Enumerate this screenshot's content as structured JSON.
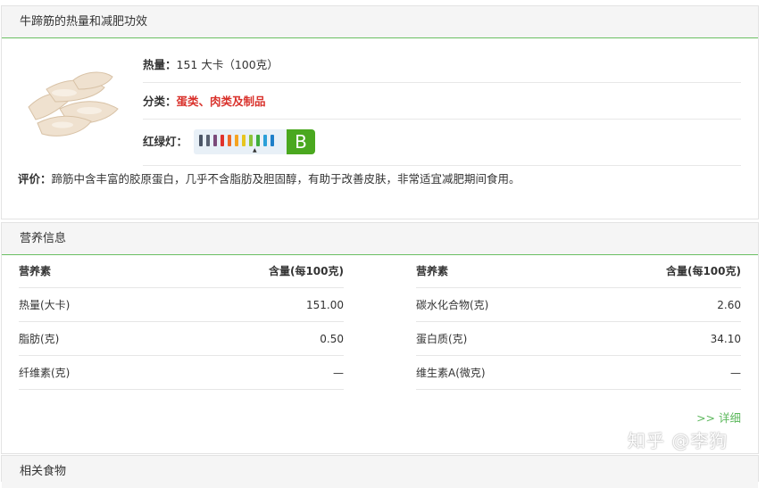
{
  "food_section": {
    "title": "牛蹄筋的热量和减肥功效",
    "calorie": {
      "label": "热量：",
      "value": "151 大卡（100克）"
    },
    "category": {
      "label": "分类：",
      "value": "蛋类、肉类及制品"
    },
    "traffic_light": {
      "label": "红绿灯：",
      "grade": "B",
      "grade_color": "#4aa81f"
    },
    "review": {
      "label": "评价：",
      "text": "蹄筋中含丰富的胶原蛋白，几乎不含脂肪及胆固醇，有助于改善皮肤，非常适宜减肥期间食用。"
    }
  },
  "nutrition_section": {
    "title": "营养信息",
    "left_columns": [
      "营养素",
      "含量(每100克)"
    ],
    "right_columns": [
      "营养素",
      "含量(每100克)"
    ],
    "left_rows": [
      {
        "name": "热量(大卡)",
        "value": "151.00"
      },
      {
        "name": "脂肪(克)",
        "value": "0.50"
      },
      {
        "name": "纤维素(克)",
        "value": "—"
      }
    ],
    "right_rows": [
      {
        "name": "碳水化合物(克)",
        "value": "2.60"
      },
      {
        "name": "蛋白质(克)",
        "value": "34.10"
      },
      {
        "name": "维生素A(微克)",
        "value": "—"
      }
    ],
    "more_link": ">> 详细"
  },
  "related_section": {
    "title": "相关食物"
  },
  "watermark": "知乎 @李狗",
  "colors": {
    "accent_green": "#6abf62",
    "category_red": "#d9322c",
    "link_green": "#5cb85c"
  }
}
